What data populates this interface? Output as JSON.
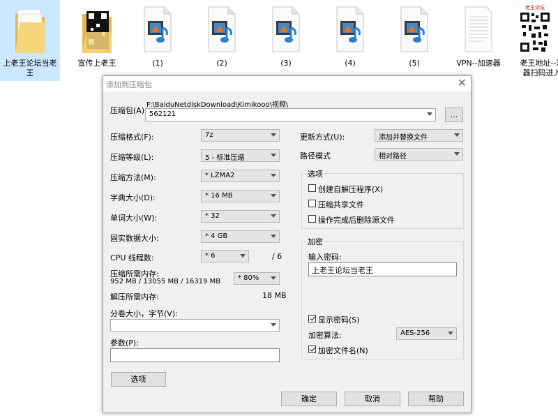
{
  "desktop": {
    "files": [
      {
        "label": "上老王论坛当老\n王",
        "icon": "folder-icon"
      },
      {
        "label": "宣传上老王",
        "icon": "qr-folder-icon"
      },
      {
        "label": "(1)",
        "icon": "video-file-icon"
      },
      {
        "label": "(2)",
        "icon": "video-file-icon"
      },
      {
        "label": "(3)",
        "icon": "video-file-icon"
      },
      {
        "label": "(4)",
        "icon": "video-file-icon"
      },
      {
        "label": "(5)",
        "icon": "video-file-icon"
      },
      {
        "label": "VPN--加速器",
        "icon": "text-document-icon"
      },
      {
        "label": "老王地址--浏\n器扫码进入",
        "icon": "qr-image-icon",
        "caption": "老王论坛"
      }
    ]
  },
  "dialog": {
    "title": "添加到压缩包",
    "close_glyph": "✕",
    "archive": {
      "label": "压缩包(A)",
      "path": "F:\\BaiduNetdiskDownload\\Kimikooo\\视频\\",
      "value": "562121",
      "browse_label": "..."
    },
    "left": {
      "format": {
        "label": "压缩格式(F):",
        "value": "7z"
      },
      "level": {
        "label": "压缩等级(L):",
        "value": "5 - 标准压缩"
      },
      "method": {
        "label": "压缩方法(M):",
        "value": "* LZMA2"
      },
      "dict": {
        "label": "字典大小(D):",
        "value": "* 16 MB"
      },
      "word": {
        "label": "单词大小(W):",
        "value": "* 32"
      },
      "solid": {
        "label": "固实数据大小:",
        "value": "* 4 GB"
      },
      "cpu": {
        "label": "CPU 线程数:",
        "value": "* 6",
        "max": "/ 6"
      },
      "memory": {
        "label": "压缩所需内存:",
        "detail": "952 MB / 13055 MB / 16319 MB",
        "value": "* 80%"
      },
      "decompress": {
        "label": "解压所需内存:",
        "value": "18 MB"
      },
      "split": {
        "label": "分卷大小，字节(V):",
        "value": ""
      },
      "params": {
        "label": "参数(P):",
        "value": ""
      },
      "options_button": "选项"
    },
    "right": {
      "update": {
        "label": "更新方式(U):",
        "value": "添加并替换文件"
      },
      "path_mode": {
        "label": "路径模式",
        "value": "相对路径"
      },
      "options": {
        "title": "选项",
        "sfx": {
          "label": "创建自解压程序(X)",
          "checked": false
        },
        "shared": {
          "label": "压缩共享文件",
          "checked": false
        },
        "delete": {
          "label": "操作完成后删除源文件",
          "checked": false
        }
      },
      "encryption": {
        "title": "加密",
        "password_label": "输入密码:",
        "password_value": "上老王论坛当老王",
        "show_password": {
          "label": "显示密码(S)",
          "checked": true
        },
        "method_label": "加密算法:",
        "method_value": "AES-256",
        "encrypt_names": {
          "label": "加密文件名(N)",
          "checked": true
        }
      }
    },
    "buttons": {
      "ok": "确定",
      "cancel": "取消",
      "help": "帮助"
    }
  },
  "colors": {
    "selection": "#cce8ff",
    "dialog_bg": "#f0f0f0",
    "qr_red": "#d0021b"
  }
}
